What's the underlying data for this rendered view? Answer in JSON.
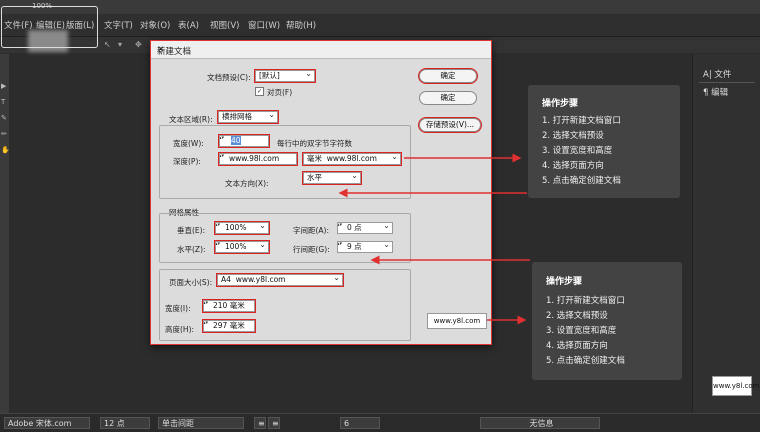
{
  "app": {
    "zoom": "100%",
    "menus": [
      "文件(F)",
      "编辑(E)",
      "版面(L)",
      "文字(T)",
      "对象(O)",
      "表(A)",
      "视图(V)",
      "窗口(W)",
      "帮助(H)"
    ],
    "right_panel": {
      "items": [
        "文件",
        "编辑"
      ]
    },
    "status": {
      "font": "Adobe 宋体.com",
      "size": "12 点",
      "style": "单击间距",
      "field1": "6",
      "style_name": "无信息"
    }
  },
  "dialog": {
    "title": "新建文档",
    "preset_label": "文档预设(C):",
    "preset_value": "[默认]",
    "facing_label": "对页(F)",
    "text_area_label": "文本区域(R):",
    "text_area_value": "横排网格",
    "char_count_label": "宽度(W):",
    "char_count_value": "40",
    "char_count_note": "每行中的双字节字符数",
    "depth_label": "深度(P):",
    "depth_value": "www.98l.com",
    "depth_unit": "毫米",
    "depth_unit_value": "www.98l.com",
    "direction_label": "文本方向(X):",
    "direction_value": "水平",
    "grid_section": "网格属性",
    "vscale_label": "垂直(E):",
    "vscale_value": "100%",
    "hscale_label": "水平(Z):",
    "hscale_value": "100%",
    "char_space_label": "字间距(A):",
    "char_space_value": "0 点",
    "line_space_label": "行间距(G):",
    "line_space_value": "9 点",
    "page_size_label": "页面大小(S):",
    "page_size_value": "A4",
    "page_size_watermark": "www.y8l.com",
    "width_label": "宽度(I):",
    "width_value": "210 毫米",
    "height_label": "高度(H):",
    "height_value": "297 毫米",
    "ok_button": "确定",
    "ok_button2": "确定",
    "save_preset_button": "存储预设(V)...",
    "watermark_box": "www.y8l.com"
  },
  "steps_top": {
    "title": "操作步骤",
    "items": [
      "1. 打开新建文档窗口",
      "2. 选择文档预设",
      "3. 设置宽度和高度",
      "4. 选择页面方向",
      "5. 点击确定创建文档"
    ]
  },
  "steps_bottom": {
    "title": "操作步骤",
    "items": [
      "1. 打开新建文档窗口",
      "2. 选择文档预设",
      "3. 设置宽度和高度",
      "4. 选择页面方向",
      "5. 点击确定创建文档"
    ]
  },
  "corner_watermark": "www.y8l.com"
}
